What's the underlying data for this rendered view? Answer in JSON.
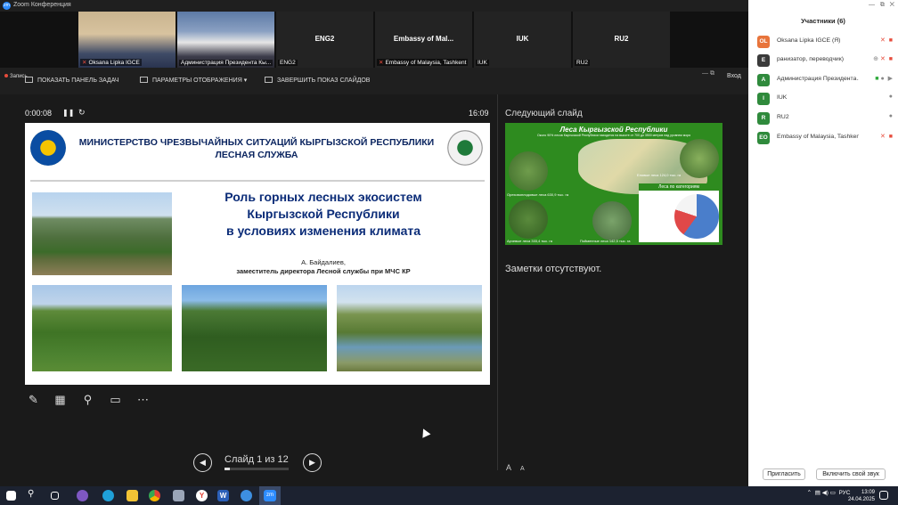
{
  "window": {
    "title": "Zoom Конференция",
    "app_logo": "zm"
  },
  "video_strip": [
    {
      "name": "Oksana Lipka IGCE",
      "big_label": "",
      "muted": true
    },
    {
      "name": "Администрация Президента Кы...",
      "big_label": "",
      "muted": false
    },
    {
      "name": "ENG2",
      "big_label": "ENG2",
      "muted": false
    },
    {
      "name": "Embassy of Malaysia, Tashkent",
      "big_label": "Embassy of Mal...",
      "muted": true
    },
    {
      "name": "IUK",
      "big_label": "IUK",
      "muted": false
    },
    {
      "name": "RU2",
      "big_label": "RU2",
      "muted": false
    }
  ],
  "toolbar": {
    "recording": "Запись",
    "show_taskbar": "ПОКАЗАТЬ ПАНЕЛЬ ЗАДАЧ",
    "display_settings": "ПАРАМЕТРЫ ОТОБРАЖЕНИЯ ▾",
    "end_slideshow": "ЗАВЕРШИТЬ ПОКАЗ СЛАЙДОВ",
    "exit": "Вход"
  },
  "presenter": {
    "elapsed": "0:00:08",
    "clock": "16:09",
    "slide_counter": "Слайд 1 из 12",
    "progress": 0.083,
    "next_slide_label": "Следующий слайд",
    "notes": "Заметки отсутствуют."
  },
  "slide": {
    "header_line1": "МИНИСТЕРСТВО ЧРЕЗВЫЧАЙНЫХ СИТУАЦИЙ КЫРГЫЗСКОЙ РЕСПУБЛИКИ",
    "header_line2": "ЛЕСНАЯ СЛУЖБА",
    "title_line1": "Роль горных лесных экосистем",
    "title_line2": "Кыргызской Республики",
    "title_line3": "в условиях изменения климата",
    "author": "А. Байдалиев,",
    "author_position": "заместитель директора Лесной службы при МЧС КР"
  },
  "next_slide": {
    "title": "Леса Кыргызской Республики",
    "subtitle": "Около 90% лесов Кыргызской Республики находится на высоте от 700 до 3500 метров над уровнем моря",
    "labels": [
      "Еловые леса 124,0 тыс. га",
      "Ореховоплодовые леса 630,9 тыс. га",
      "Арчевые леса 333,4 тыс. га",
      "Пойменные леса 142,5 тыс. га",
      "Леса по категориям"
    ]
  },
  "participants": {
    "header": "Участники (6)",
    "list": [
      {
        "initials": "OL",
        "name": "Oksana Lipka IGCE (Я)",
        "color": "#e8743b",
        "mic_muted": true,
        "video_off": true
      },
      {
        "initials": "E",
        "name": "ранизатор, переводчик)",
        "color": "#3a3a3a",
        "mic_muted": true,
        "video_off": true
      },
      {
        "initials": "A",
        "name": "Администрация Президента...",
        "color": "#2f8a3c",
        "mic_muted": false,
        "video_off": false
      },
      {
        "initials": "I",
        "name": "IUK",
        "color": "#2f8a3c",
        "mic_muted": false,
        "video_off": false
      },
      {
        "initials": "R",
        "name": "RU2",
        "color": "#2f8a3c",
        "mic_muted": false,
        "video_off": false
      },
      {
        "initials": "EO",
        "name": "Embassy of Malaysia, Tashkent",
        "color": "#2f8a3c",
        "mic_muted": true,
        "video_off": true
      }
    ],
    "invite": "Пригласить",
    "unmute_me": "Включить свой звук"
  },
  "taskbar": {
    "lang": "РУС",
    "time": "13:09",
    "date": "24.04.2025"
  }
}
